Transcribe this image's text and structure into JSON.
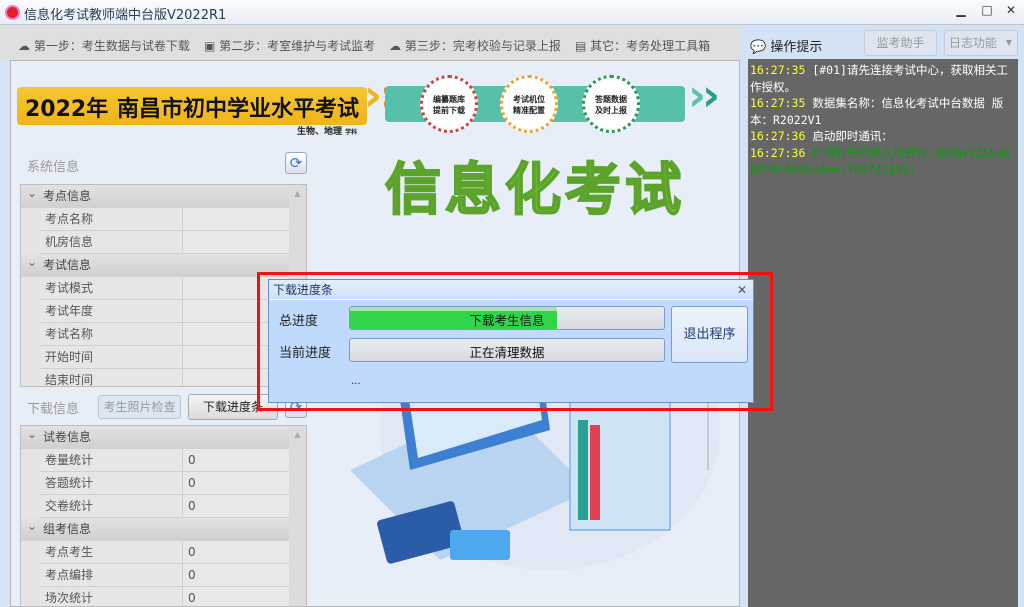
{
  "window": {
    "title": "信息化考试教师端中台版V2022R1",
    "min": "▁",
    "max": "□",
    "close": "✕"
  },
  "toolbar": {
    "steps": [
      "第一步：考生数据与试卷下载",
      "第二步：考室维护与考试监考",
      "第三步：完考校验与记录上报",
      "其它：考务处理工具箱"
    ]
  },
  "banner": {
    "year": "2022年",
    "name": "南昌市初中学业水平考试",
    "subjects": "生物、地理",
    "subjects_suffix": "学科",
    "circles": [
      "编纂题库\n提前下载",
      "考试机位\n精准配置",
      "答题数据\n及时上报"
    ],
    "big_title": "信息化考试"
  },
  "system_info": {
    "title": "系统信息",
    "groups": [
      {
        "name": "考点信息",
        "rows": [
          {
            "k": "考点名称",
            "v": ""
          },
          {
            "k": "机房信息",
            "v": ""
          }
        ]
      },
      {
        "name": "考试信息",
        "rows": [
          {
            "k": "考试模式",
            "v": ""
          },
          {
            "k": "考试年度",
            "v": ""
          },
          {
            "k": "考试名称",
            "v": ""
          },
          {
            "k": "开始时间",
            "v": ""
          },
          {
            "k": "结束时间",
            "v": ""
          }
        ]
      }
    ]
  },
  "download_info": {
    "title": "下载信息",
    "photo_check": "考生照片检查",
    "progress_btn": "下载进度条",
    "groups": [
      {
        "name": "试卷信息",
        "rows": [
          {
            "k": "卷量统计",
            "v": "0"
          },
          {
            "k": "答题统计",
            "v": "0"
          },
          {
            "k": "交卷统计",
            "v": "0"
          }
        ]
      },
      {
        "name": "组考信息",
        "rows": [
          {
            "k": "考点考生",
            "v": "0"
          },
          {
            "k": "考点编排",
            "v": "0"
          },
          {
            "k": "场次统计",
            "v": "0"
          }
        ]
      }
    ]
  },
  "right": {
    "title": "操作提示",
    "assistant": "监考助手",
    "log_func": "日志功能",
    "log": [
      {
        "time": "16:27:35",
        "msg": "[#01]请先连接考试中心，获取相关工作授权。",
        "color": "white"
      },
      {
        "time": "16:27:35",
        "msg": "数据集名称：信息化考试中台数据 版本：R2022V1",
        "color": "white"
      },
      {
        "time": "16:27:36",
        "msg": "启动即时通讯：",
        "color": "white"
      },
      {
        "time": "16:27:36",
        "msg": "检测到已经插入加密狗:9K8hrYZ5bm6EQn0/68GSeA==(784731191)",
        "color": "green"
      }
    ]
  },
  "dialog": {
    "title": "下载进度条",
    "total_label": "总进度",
    "total_text": "下载考生信息",
    "total_progress": 0.66,
    "current_label": "当前进度",
    "current_text": "正在清理数据",
    "current_progress": 0,
    "exit": "退出程序",
    "status": "..."
  }
}
